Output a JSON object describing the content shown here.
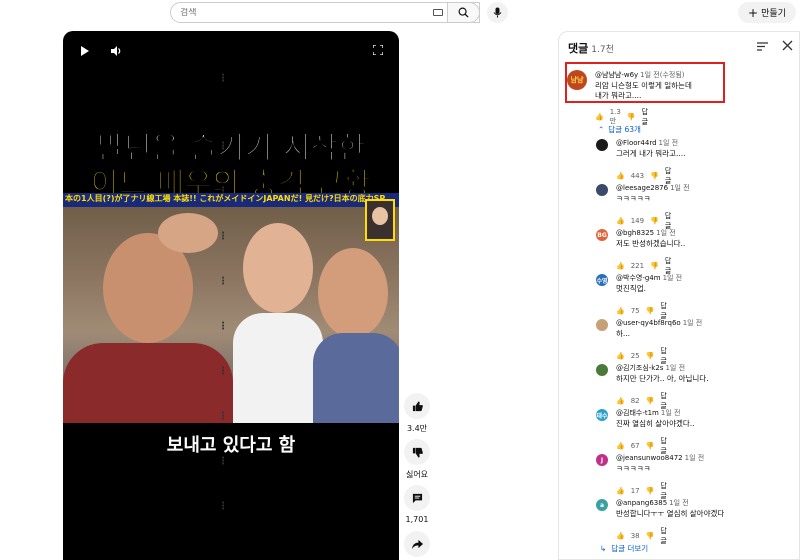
{
  "search": {
    "placeholder": "검색"
  },
  "create": {
    "label": "만들기"
  },
  "video": {
    "headline_line1": "말년을 즐기기 시작한",
    "headline_line2": "어느 배우의 충격 근황",
    "banner_text": "本の1人目(?)が了ナリ線工場  本誌!! これがメイドインJAPANだ!  見だけ?日本の底力SP",
    "subtitle": "보내고 있다고 함"
  },
  "actions": {
    "like_count": "3.4만",
    "dislike_label": "싫어요",
    "comment_count": "1,701",
    "share_label": "공유"
  },
  "comments_panel": {
    "title": "댓글",
    "count": "1.7천",
    "top_comment": {
      "avatar_text": "냠냠",
      "author": "@냠냠냠-w6y",
      "time": "1일 전(수정됨)",
      "line1": "리암 니슨형도 이렇게 일하는데",
      "line2": "내가 뭐라고....",
      "likes": "1.3만",
      "reply_label": "답글"
    },
    "replies_toggle": "답글 63개",
    "replies": [
      {
        "author": "@Floor44rd",
        "time": "1일 전",
        "text": "그러게 내가 뭐라고....",
        "likes": "443",
        "reply_label": "답글",
        "avatar_text": "",
        "avatar_color": "#1a1a1a"
      },
      {
        "author": "@leesage2876",
        "time": "1일 전",
        "text": "ㅋㅋㅋㅋㅋ",
        "likes": "149",
        "reply_label": "답글",
        "avatar_text": "",
        "avatar_color": "#3a4a6a"
      },
      {
        "author": "@bgh8325",
        "time": "1일 전",
        "text": "저도 반성하겠습니다..",
        "likes": "221",
        "reply_label": "답글",
        "avatar_text": "BG",
        "avatar_color": "#e0643a"
      },
      {
        "author": "@박수영-g4m",
        "time": "1일 전",
        "text": "멋진직업.",
        "likes": "75",
        "reply_label": "답글",
        "avatar_text": "수영",
        "avatar_color": "#2a6fb8"
      },
      {
        "author": "@user-qy4bf8rq6o",
        "time": "1일 전",
        "text": "하...",
        "likes": "25",
        "reply_label": "답글",
        "avatar_text": "",
        "avatar_color": "#c8a078"
      },
      {
        "author": "@김기조심-k2s",
        "time": "1일 전",
        "text": "하지만 단가가..  아, 아닙니다.",
        "likes": "82",
        "reply_label": "답글",
        "avatar_text": "",
        "avatar_color": "#4a7a3a"
      },
      {
        "author": "@김태수-t1m",
        "time": "1일 전",
        "text": "진짜 열심히 살아야겠다..",
        "likes": "67",
        "reply_label": "답글",
        "avatar_text": "태수",
        "avatar_color": "#2aa0c8"
      },
      {
        "author": "@jeansunwoo8472",
        "time": "1일 전",
        "text": "ㅋㅋㅋㅋㅋ",
        "likes": "17",
        "reply_label": "답글",
        "avatar_text": "J",
        "avatar_color": "#c0308a"
      },
      {
        "author": "@anpang6385",
        "time": "1일 전",
        "text": "반성합니다ㅜㅜ 열심히 살아야겠다",
        "likes": "38",
        "reply_label": "답글",
        "avatar_text": "a",
        "avatar_color": "#3aa0a0"
      }
    ],
    "more_replies": "답글 더보기"
  },
  "colors": {
    "highlight": "#e02020",
    "link": "#065fd4",
    "headline_yellow": "#ffe300"
  }
}
